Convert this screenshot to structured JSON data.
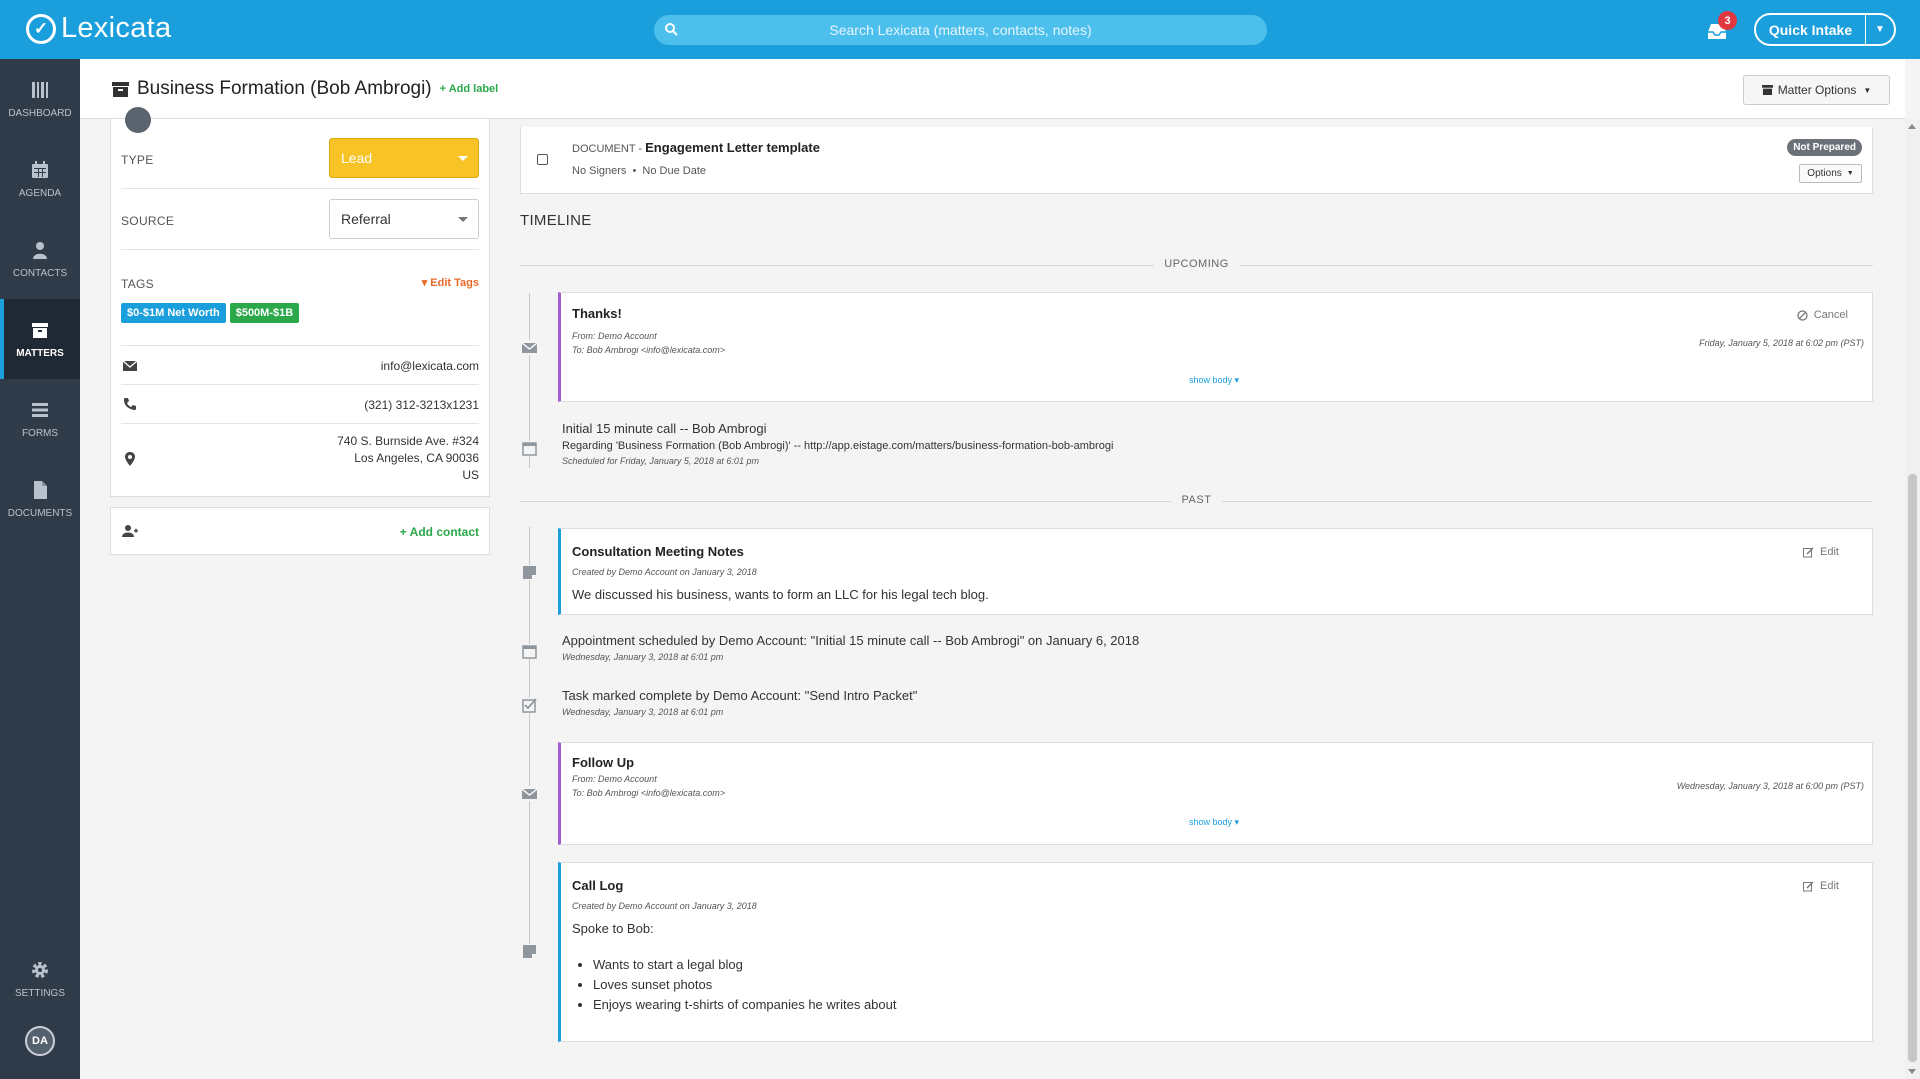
{
  "app": {
    "logo_text": "Lexicata",
    "search_placeholder": "Search Lexicata (matters, contacts, notes)",
    "notification_count": "3",
    "quick_intake_label": "Quick Intake"
  },
  "sidebar": {
    "items": [
      {
        "label": "DASHBOARD",
        "icon": "dashboard-icon"
      },
      {
        "label": "AGENDA",
        "icon": "calendar-icon"
      },
      {
        "label": "CONTACTS",
        "icon": "person-icon"
      },
      {
        "label": "MATTERS",
        "icon": "archive-icon",
        "active": true
      },
      {
        "label": "FORMS",
        "icon": "list-icon"
      },
      {
        "label": "DOCUMENTS",
        "icon": "document-icon"
      }
    ],
    "settings_label": "SETTINGS",
    "user_initials": "DA"
  },
  "header": {
    "matter_title": "Business Formation (Bob Ambrogi)",
    "add_label": "Add label",
    "matter_options": "Matter Options"
  },
  "details": {
    "type_label": "TYPE",
    "type_value": "Lead",
    "source_label": "SOURCE",
    "source_value": "Referral",
    "tags_label": "TAGS",
    "edit_tags": "Edit Tags",
    "tags": [
      "$0-$1M Net Worth",
      "$500M-$1B"
    ],
    "email": "info@lexicata.com",
    "phone": "(321) 312-3213x1231",
    "address_line1": "740 S. Burnside Ave. #324",
    "address_line2": "Los Angeles, CA 90036",
    "address_country": "US",
    "add_contact": "Add contact"
  },
  "document": {
    "kind": "DOCUMENT -",
    "name": "Engagement Letter template",
    "signers": "No Signers",
    "due": "No Due Date",
    "status": "Not Prepared",
    "options_label": "Options"
  },
  "timeline": {
    "title": "TIMELINE",
    "upcoming_label": "UPCOMING",
    "past_label": "PAST",
    "email_thanks": {
      "title": "Thanks!",
      "from": "From: Demo Account",
      "to": "To: Bob Ambrogi <info@lexicata.com>",
      "date": "Friday, January 5, 2018 at 6:02 pm (PST)",
      "cancel": "Cancel",
      "show_body": "show body"
    },
    "appointment_upcoming": {
      "title": "Initial 15 minute call -- Bob Ambrogi",
      "regarding": "Regarding 'Business Formation (Bob Ambrogi)' -- http://app.eistage.com/matters/business-formation-bob-ambrogi",
      "scheduled": "Scheduled for Friday, January 5, 2018 at 6:01 pm"
    },
    "note_consultation": {
      "title": "Consultation Meeting Notes",
      "created": "Created by Demo Account on January 3, 2018",
      "body": "We discussed his business, wants to form an LLC for his legal tech blog.",
      "edit": "Edit"
    },
    "appointment_scheduled": {
      "text": "Appointment scheduled by Demo Account: \"Initial 15 minute call -- Bob Ambrogi\" on January 6, 2018",
      "time": "Wednesday, January 3, 2018 at 6:01 pm"
    },
    "task_complete": {
      "text": "Task marked complete by Demo Account: \"Send Intro Packet\"",
      "time": "Wednesday, January 3, 2018 at 6:01 pm"
    },
    "email_followup": {
      "title": "Follow Up",
      "from": "From: Demo Account",
      "to": "To: Bob Ambrogi <info@lexicata.com>",
      "date": "Wednesday, January 3, 2018 at 6:00 pm (PST)",
      "show_body": "show body"
    },
    "note_calllog": {
      "title": "Call Log",
      "created": "Created by Demo Account on January 3, 2018",
      "intro": "Spoke to Bob:",
      "bullets": [
        "Wants to start a legal blog",
        "Loves sunset photos",
        "Enjoys wearing t-shirts of companies he writes about"
      ],
      "edit": "Edit"
    }
  },
  "colors": {
    "brand_blue": "#1a9fdc",
    "sidebar": "#2f3b49",
    "lead_yellow": "#f7c325",
    "tag_blue": "#1a9fdc",
    "tag_green": "#2aa84a",
    "email_purple": "#a25fd1",
    "note_blue": "#1a9fdc",
    "add_green": "#2aa84a",
    "edit_orange": "#e8692a"
  }
}
